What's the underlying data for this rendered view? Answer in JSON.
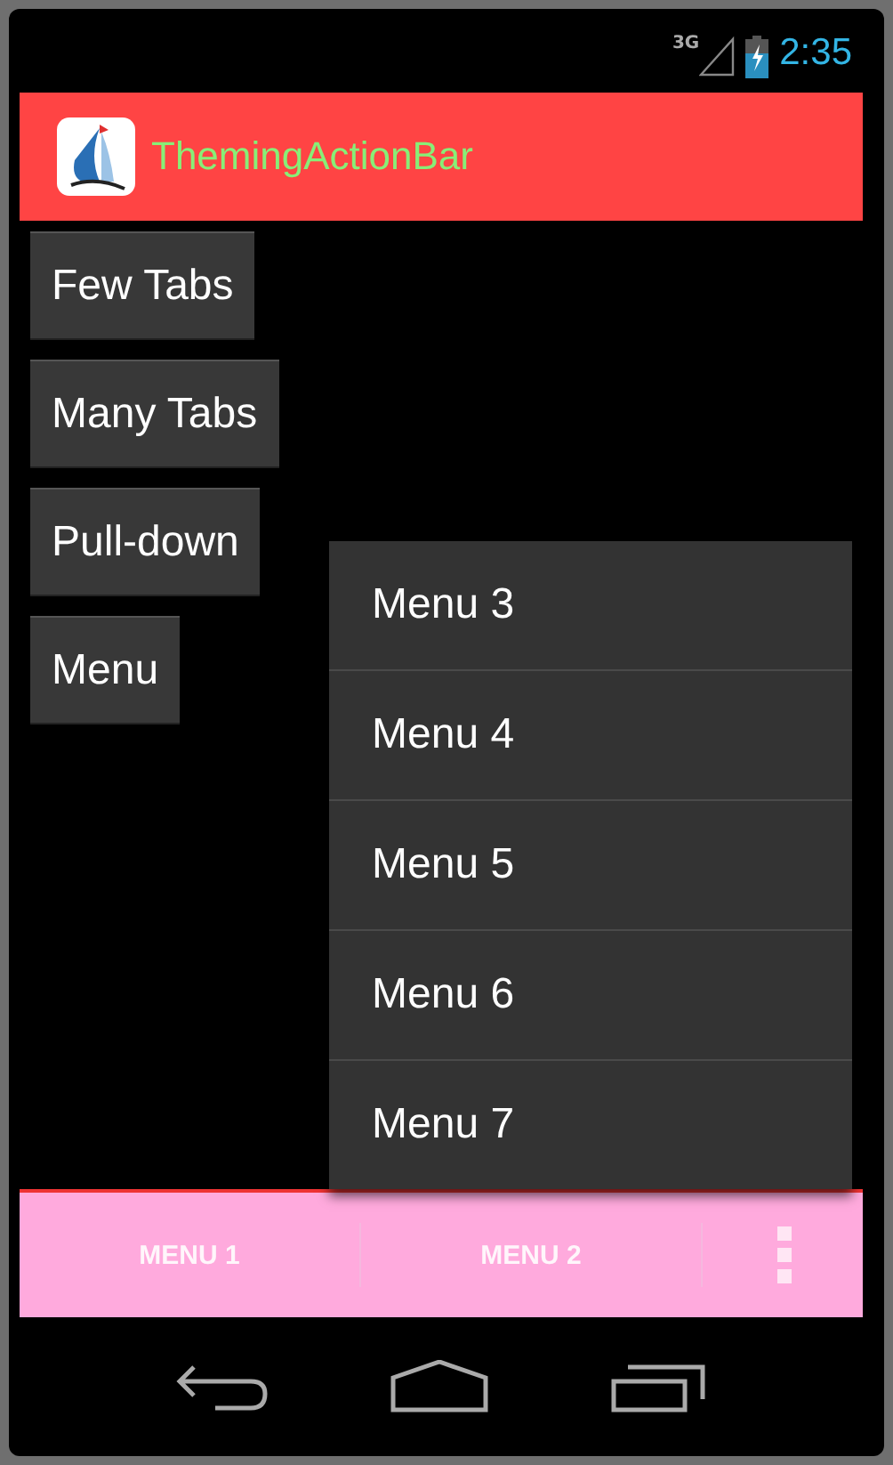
{
  "status_bar": {
    "network": "3G",
    "time": "2:35"
  },
  "action_bar": {
    "title": "ThemingActionBar"
  },
  "buttons": [
    "Few Tabs",
    "Many Tabs",
    "Pull-down",
    "Menu"
  ],
  "popup_menu": {
    "items": [
      "Menu 3",
      "Menu 4",
      "Menu 5",
      "Menu 6",
      "Menu 7"
    ]
  },
  "split_action_bar": {
    "items": [
      "MENU 1",
      "MENU 2"
    ]
  }
}
